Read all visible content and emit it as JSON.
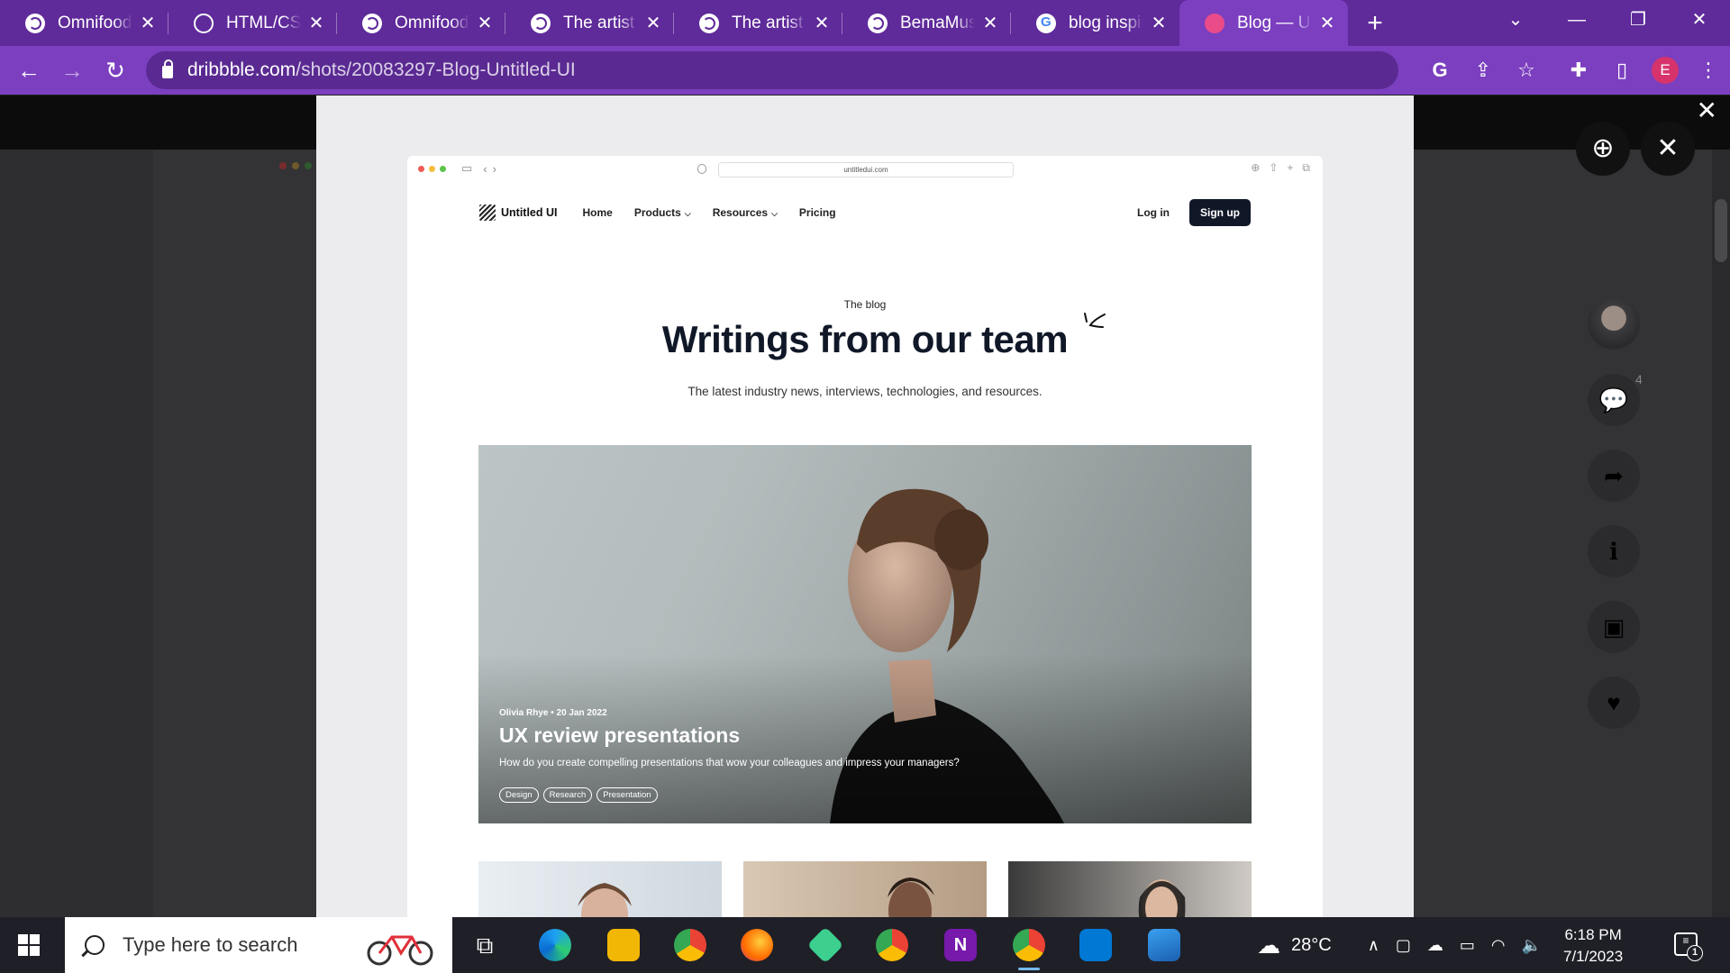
{
  "browser": {
    "tabs": [
      {
        "title": "Omnifood",
        "icon": "globe-icon"
      },
      {
        "title": "HTML/CSS",
        "icon": "chatgpt-icon"
      },
      {
        "title": "Omnifood",
        "icon": "globe-icon"
      },
      {
        "title": "The artist p",
        "icon": "globe-icon"
      },
      {
        "title": "The artist p",
        "icon": "globe-icon"
      },
      {
        "title": "BemaMusic",
        "icon": "globe-icon"
      },
      {
        "title": "blog inspira",
        "icon": "google-icon"
      },
      {
        "title": "Blog — Unt",
        "icon": "dribbble-icon",
        "active": true
      }
    ],
    "url_domain": "dribbble.com",
    "url_path": "/shots/20083297-Blog-Untitled-UI",
    "profile_initial": "E",
    "accent": "#7b3fbf"
  },
  "shot": {
    "mini_url": "untitledui.com",
    "logo_text": "Untitled UI",
    "nav": {
      "home": "Home",
      "products": "Products",
      "resources": "Resources",
      "pricing": "Pricing",
      "login": "Log in",
      "signup": "Sign up"
    },
    "eyebrow": "The blog",
    "title": "Writings from our team",
    "subtitle": "The latest industry news, interviews, technologies, and resources.",
    "featured": {
      "meta": "Olivia Rhye • 20 Jan 2022",
      "title": "UX review presentations",
      "description": "How do you create compelling presentations that wow your colleagues and impress your managers?",
      "tags": [
        "Design",
        "Research",
        "Presentation"
      ]
    }
  },
  "rail": {
    "comment_count": "4"
  },
  "taskbar": {
    "search_placeholder": "Type here to search",
    "temperature": "28°C",
    "time": "6:18 PM",
    "date": "7/1/2023",
    "notification_count": "1"
  }
}
